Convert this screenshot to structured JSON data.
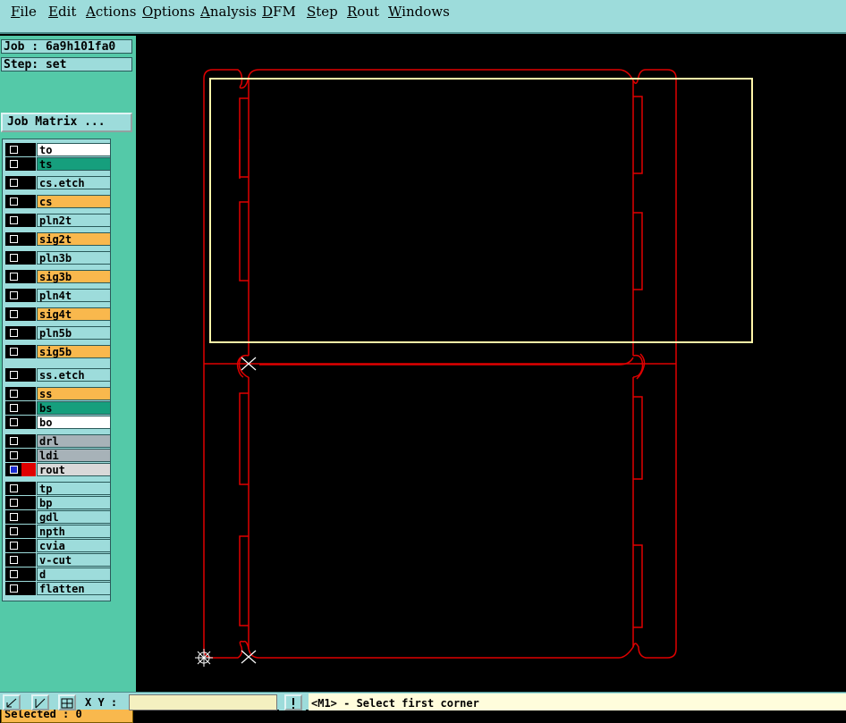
{
  "menu": [
    "File",
    "Edit",
    "Actions",
    "Options",
    "Analysis",
    "DFM",
    "Step",
    "Rout",
    "Windows"
  ],
  "job_label": "Job : 6a9h101fa0",
  "step_label": "Step: set",
  "job_matrix_label": "Job Matrix ...",
  "layers": [
    {
      "name": "to",
      "bg": "#ffffff"
    },
    {
      "name": "ts",
      "bg": "#169f7d"
    },
    {
      "name": "cs.etch",
      "bg": "#9ddcdb"
    },
    {
      "name": "cs",
      "bg": "#f9b84d"
    },
    {
      "name": "pln2t",
      "bg": "#9ddcdb"
    },
    {
      "name": "sig2t",
      "bg": "#f9b84d"
    },
    {
      "name": "pln3b",
      "bg": "#9ddcdb"
    },
    {
      "name": "sig3b",
      "bg": "#f9b84d"
    },
    {
      "name": "pln4t",
      "bg": "#9ddcdb"
    },
    {
      "name": "sig4t",
      "bg": "#f9b84d"
    },
    {
      "name": "pln5b",
      "bg": "#9ddcdb"
    },
    {
      "name": "sig5b",
      "bg": "#f9b84d"
    },
    {
      "name": "ss.etch",
      "bg": "#9ddcdb"
    },
    {
      "name": "ss",
      "bg": "#f9b84d"
    },
    {
      "name": "bs",
      "bg": "#169f7d"
    },
    {
      "name": "bo",
      "bg": "#ffffff"
    },
    {
      "name": "drl",
      "bg": "#a7b2b8"
    },
    {
      "name": "ldi",
      "bg": "#a7b2b8"
    },
    {
      "name": "rout",
      "bg": "#d9d9d9",
      "active": true
    },
    {
      "name": "tp",
      "bg": "#9ddcdb"
    },
    {
      "name": "bp",
      "bg": "#9ddcdb"
    },
    {
      "name": "gdl",
      "bg": "#9ddcdb"
    },
    {
      "name": "npth",
      "bg": "#9ddcdb"
    },
    {
      "name": "cvia",
      "bg": "#9ddcdb"
    },
    {
      "name": "v-cut",
      "bg": "#9ddcdb"
    },
    {
      "name": "d",
      "bg": "#9ddcdb"
    },
    {
      "name": "flatten",
      "bg": "#9ddcdb"
    }
  ],
  "selected_label": "Selected : 0",
  "xy_label": "X Y :",
  "xy_value": "",
  "message": "<M1> - Select first corner",
  "colors": {
    "rout": "#e00000",
    "selection": "#fff5a8"
  }
}
